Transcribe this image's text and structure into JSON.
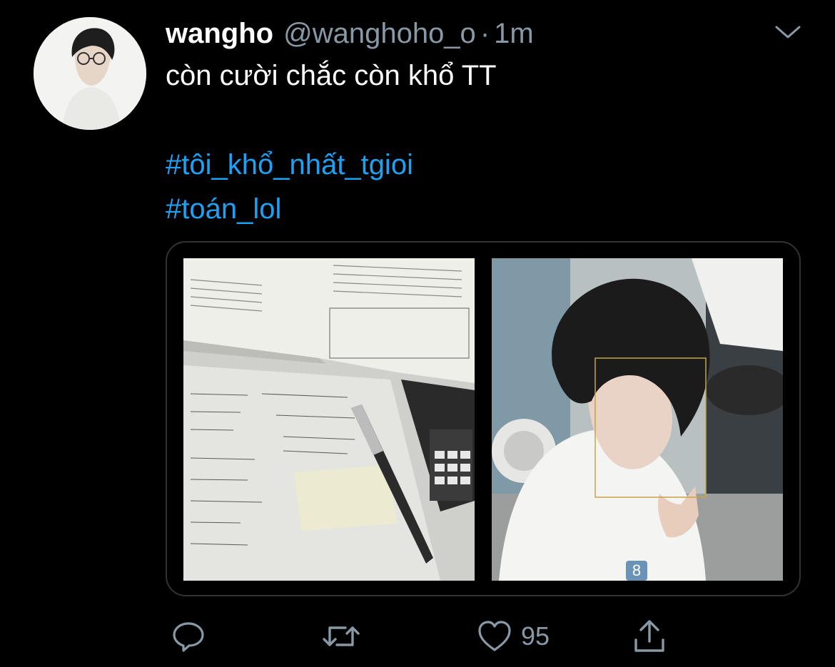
{
  "tweet": {
    "display_name": "wangho",
    "handle": "@wanghoho_o",
    "separator": "·",
    "time": "1m",
    "text": "còn cười chắc còn khổ TT",
    "hashtags": [
      "#tôi_khổ_nhất_tgioi",
      "#toán_lol"
    ],
    "media": {
      "photo_count_badge": "8"
    },
    "actions": {
      "reply_icon": "reply-icon",
      "retweet_icon": "retweet-icon",
      "like_icon": "heart-icon",
      "like_count": "95",
      "share_icon": "share-icon"
    }
  },
  "colors": {
    "background": "#000000",
    "text": "#ffffff",
    "secondary": "#8899a6",
    "link": "#1da1f2",
    "border": "#2f3336"
  }
}
